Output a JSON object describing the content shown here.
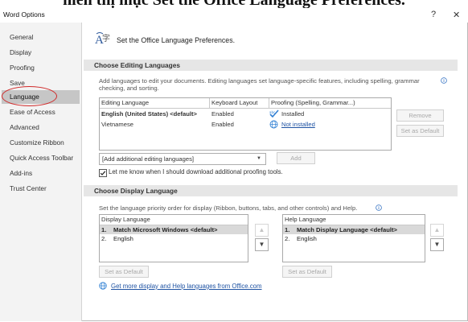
{
  "overlay": {
    "text": "hiển thị mục Set the Office Language Preferences."
  },
  "window": {
    "title": "Word Options",
    "help": "?",
    "close": "✕"
  },
  "sidebar": {
    "items": [
      {
        "label": "General"
      },
      {
        "label": "Display"
      },
      {
        "label": "Proofing"
      },
      {
        "label": "Save"
      },
      {
        "label": "Language"
      },
      {
        "label": "Ease of Access"
      },
      {
        "label": "Advanced"
      },
      {
        "label": "Customize Ribbon"
      },
      {
        "label": "Quick Access Toolbar"
      },
      {
        "label": "Add-ins"
      },
      {
        "label": "Trust Center"
      }
    ],
    "selected": "Language"
  },
  "header": {
    "title": "Set the Office Language Preferences."
  },
  "editing": {
    "section_title": "Choose Editing Languages",
    "description": "Add languages to edit your documents. Editing languages set language-specific features, including spelling, grammar checking, and sorting.",
    "columns": [
      "Editing Language",
      "Keyboard Layout",
      "Proofing (Spelling, Grammar...)"
    ],
    "rows": [
      {
        "language": "English (United States) <default>",
        "keyboard": "Enabled",
        "proofing": "Installed"
      },
      {
        "language": "Vietnamese",
        "keyboard": "Enabled",
        "proofing": "Not installed"
      }
    ],
    "remove_label": "Remove",
    "set_default_label": "Set as Default",
    "add_dropdown_value": "[Add additional editing languages]",
    "add_label": "Add",
    "notify_label": "Let me know when I should download additional proofing tools.",
    "notify_checked": true
  },
  "display": {
    "section_title": "Choose Display Language",
    "description": "Set the language priority order for display (Ribbon, buttons, tabs, and other controls) and Help.",
    "display_list": {
      "header": "Display Language",
      "items": [
        {
          "num": "1.",
          "label": "Match Microsoft Windows <default>"
        },
        {
          "num": "2.",
          "label": "English"
        }
      ]
    },
    "help_list": {
      "header": "Help Language",
      "items": [
        {
          "num": "1.",
          "label": "Match Display Language <default>"
        },
        {
          "num": "2.",
          "label": "English"
        }
      ]
    },
    "set_default_label": "Set as Default",
    "get_more_link": "Get more display and Help languages from Office.com"
  },
  "colors": {
    "accent_link": "#1f53a3",
    "selection": "#c6c6c6",
    "annotation": "#d02a2a"
  }
}
